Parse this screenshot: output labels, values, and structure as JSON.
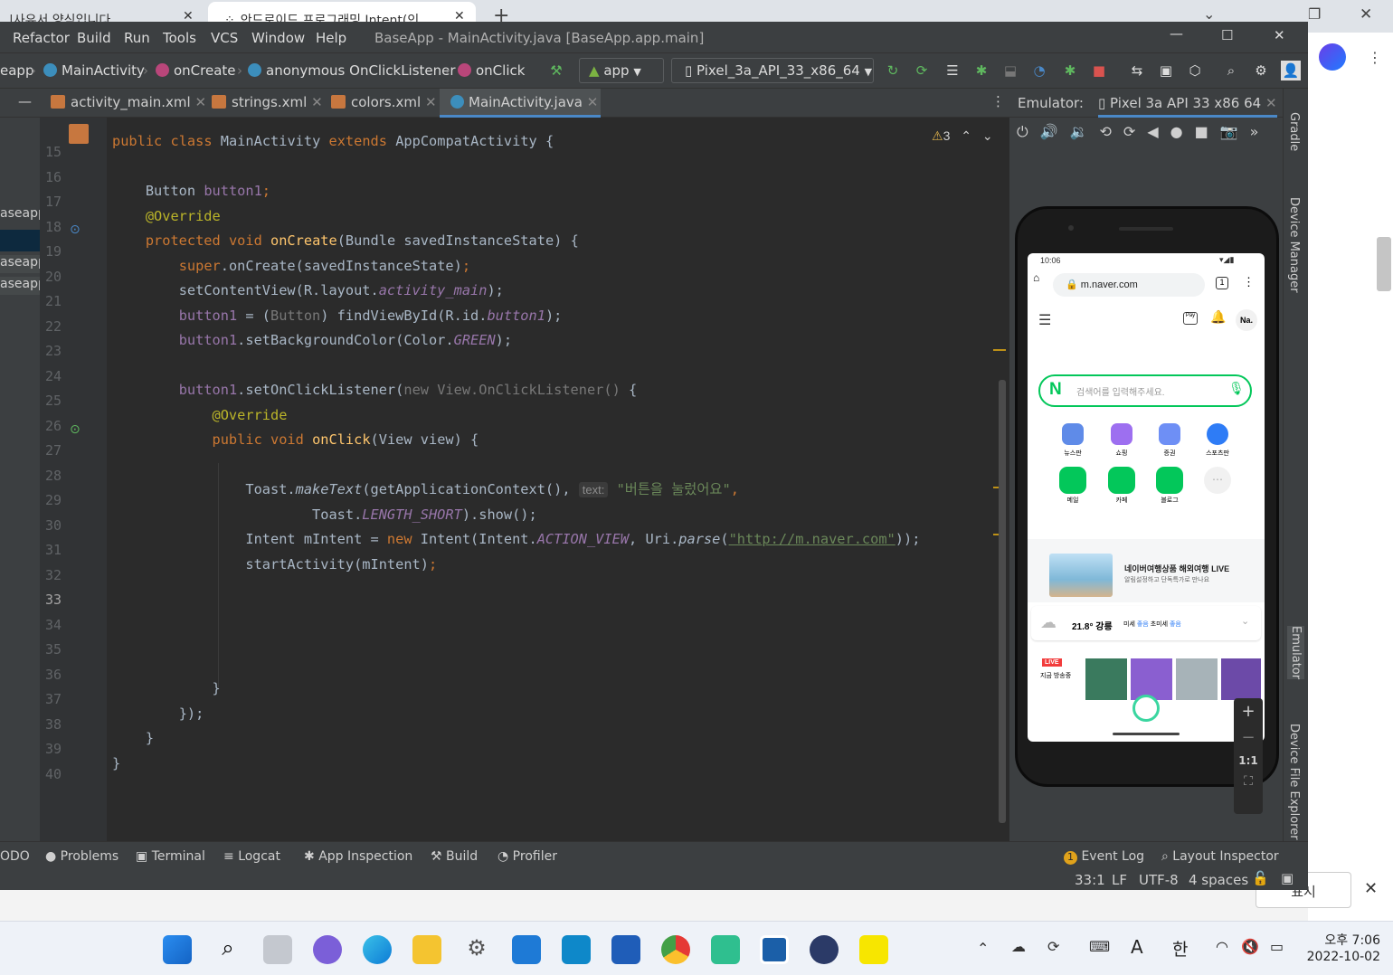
{
  "browser": {
    "tab1": "|사유서 양식입니다.",
    "tab2": "안드로이드 프로그래밍 Intent(인"
  },
  "menu": {
    "items": [
      "Refactor",
      "Build",
      "Run",
      "Tools",
      "VCS",
      "Window",
      "Help"
    ],
    "title": "BaseApp - MainActivity.java [BaseApp.app.main]"
  },
  "nav": {
    "c0": "eapp",
    "c1": "MainActivity",
    "c2": "onCreate",
    "c3": "anonymous OnClickListener",
    "c4": "onClick",
    "config": "app",
    "device": "Pixel_3a_API_33_x86_64"
  },
  "tabs": [
    "activity_main.xml",
    "strings.xml",
    "colors.xml",
    "MainActivity.java"
  ],
  "project": {
    "items": [
      "aseapp",
      "aseapp",
      "aseapp"
    ]
  },
  "editor": {
    "warnings": "3",
    "lines": [
      "15",
      "16",
      "17",
      "18",
      "19",
      "20",
      "21",
      "22",
      "23",
      "24",
      "25",
      "26",
      "27",
      "28",
      "29",
      "30",
      "31",
      "32",
      "33",
      "34",
      "35",
      "36",
      "37",
      "38",
      "39",
      "40"
    ],
    "code": {
      "l15_kw1": "public",
      "l15_kw2": "class",
      "l15_name": "MainActivity",
      "l15_kw3": "extends",
      "l15_rest": "AppCompatActivity {",
      "l17_type": "Button",
      "l17_var": "button1",
      "l18": "@Override",
      "l19_kw1": "protected",
      "l19_kw2": "void",
      "l19_fn": "onCreate",
      "l19_rest": "(Bundle savedInstanceState) {",
      "l20_kw": "super",
      "l20_rest": ".onCreate(savedInstanceState)",
      "l21_a": "setContentView(R.layout.",
      "l21_b": "activity_main",
      "l21_c": ");",
      "l22_a": "button1",
      "l22_b": " = (",
      "l22_c": "Button",
      "l22_d": ") findViewById(R.id.",
      "l22_e": "button1",
      "l22_f": ");",
      "l23_a": "button1",
      ".": ".",
      "l23_b": ".setBackgroundColor(Color.",
      "l23_c": "GREEN",
      "l23_d": ");",
      "l25_a": "button1",
      "l25_b": ".setOnClickListener(",
      "l25_c": "new View.OnClickListener()",
      "l25_d": " {",
      "l26": "@Override",
      "l27_kw1": "public",
      "l27_kw2": "void",
      "l27_fn": "onClick",
      "l27_rest": "(View view) {",
      "l29_a": "Toast.",
      "l29_b": "makeText",
      "l29_c": "(getApplicationContext(),",
      "l29_hint": "text:",
      "l29_str": "\"버튼을 눌렀어요\"",
      "l30_a": "Toast.",
      "l30_b": "LENGTH_SHORT",
      "l30_c": ").show();",
      "l31_a": "Intent mIntent = ",
      "l31_kw": "new",
      "l31_b": " Intent(Intent.",
      "l31_c": "ACTION_VIEW",
      "l31_d": ", Uri.",
      "l31_e": "parse",
      "l31_f": "(",
      "l31_str": "\"http://m.naver.com\"",
      "l31_g": "));",
      "l32": "startActivity(mIntent)",
      "l37": "}",
      "l38": "});",
      "l39": "}",
      "l40": "}"
    }
  },
  "emulator": {
    "label": "Emulator:",
    "device": "Pixel 3a API 33 x86 64",
    "zoom": "1:1"
  },
  "phone": {
    "time": "10:06",
    "url": "m.naver.com",
    "user": "Na.",
    "search_placeholder": "검색어를 입력해주세요.",
    "shortcuts": [
      "뉴스판",
      "쇼핑",
      "증권",
      "스포츠판",
      "메일",
      "카페",
      "블로그"
    ],
    "promo_title": "네이버여행상품 해외여행 LIVE",
    "promo_sub": "알림설정하고 단독특가로 만나요",
    "weather": "21.8° 강릉",
    "weather_b": "미세",
    "weather_c": "좋음",
    "weather_d": "초미세",
    "weather_e": "좋음",
    "live": "LIVE",
    "live_sub": "지금 방송중"
  },
  "rightstrip": [
    "Gradle",
    "Device Manager",
    "Emulator",
    "Device File Explorer"
  ],
  "toolwindows": [
    "ODO",
    "Problems",
    "Terminal",
    "Logcat",
    "App Inspection",
    "Build",
    "Profiler",
    "Event Log",
    "Layout Inspector"
  ],
  "status": {
    "pos": "33:1",
    "lf": "LF",
    "enc": "UTF-8",
    "indent": "4 spaces",
    "event_count": "1"
  },
  "page_right": {
    "btn": "표시"
  },
  "taskbar": {
    "lang_a": "A",
    "lang_b": "한",
    "time": "오후 7:06",
    "date": "2022-10-02"
  }
}
